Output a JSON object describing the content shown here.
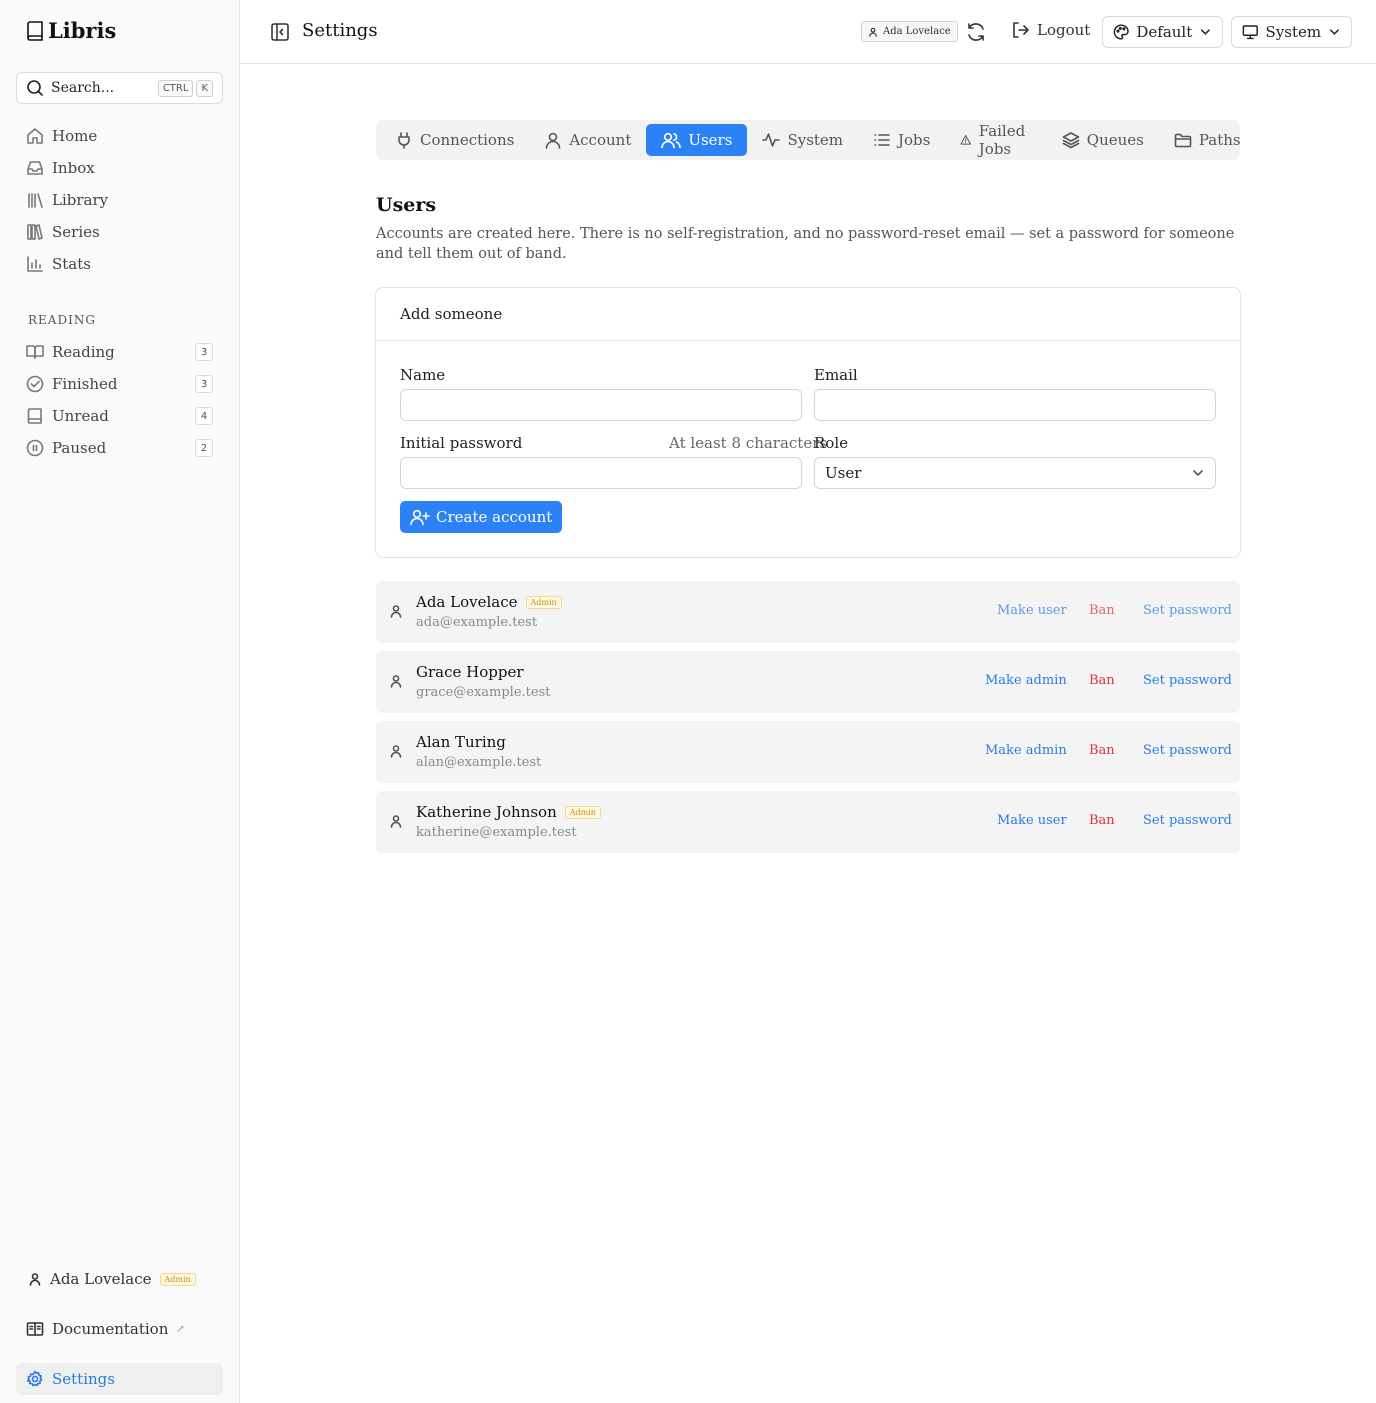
{
  "app": {
    "brand": "Libris"
  },
  "sidebar": {
    "search": {
      "label": "Search...",
      "kbd1": "CTRL",
      "kbd2": "K"
    },
    "nav": [
      {
        "label": "Home",
        "icon": "home-icon"
      },
      {
        "label": "Inbox",
        "icon": "inbox-icon"
      },
      {
        "label": "Library",
        "icon": "library-icon"
      },
      {
        "label": "Series",
        "icon": "series-icon"
      },
      {
        "label": "Stats",
        "icon": "stats-icon"
      }
    ],
    "reading_section": "READING",
    "reading": [
      {
        "label": "Reading",
        "count": "3",
        "icon": "book-open-icon"
      },
      {
        "label": "Finished",
        "count": "3",
        "icon": "check-circle-icon"
      },
      {
        "label": "Unread",
        "count": "4",
        "icon": "book-icon"
      },
      {
        "label": "Paused",
        "count": "2",
        "icon": "pause-circle-icon"
      }
    ],
    "user": {
      "name": "Ada Lovelace",
      "badge": "Admin"
    },
    "documentation": "Documentation",
    "settings": "Settings"
  },
  "header": {
    "title": "Settings",
    "user_chip": "Ada Lovelace",
    "logout": "Logout",
    "theme": "Default",
    "mode": "System"
  },
  "tabs": [
    {
      "label": "Connections",
      "icon": "plug-icon",
      "active": false
    },
    {
      "label": "Account",
      "icon": "user-icon",
      "active": false
    },
    {
      "label": "Users",
      "icon": "users-icon",
      "active": true
    },
    {
      "label": "System",
      "icon": "activity-icon",
      "active": false
    },
    {
      "label": "Jobs",
      "icon": "list-icon",
      "active": false
    },
    {
      "label": "Failed Jobs",
      "icon": "warning-icon",
      "active": false
    },
    {
      "label": "Queues",
      "icon": "layers-icon",
      "active": false
    },
    {
      "label": "Paths",
      "icon": "folder-icon",
      "active": false
    }
  ],
  "page": {
    "heading": "Users",
    "description": "Accounts are created here. There is no self-registration, and no password-reset email — set a password for someone and tell them out of band."
  },
  "form": {
    "title": "Add someone",
    "name_label": "Name",
    "name_value": "",
    "email_label": "Email",
    "email_value": "",
    "password_label": "Initial password",
    "password_hint": "At least 8 characters",
    "password_value": "",
    "role_label": "Role",
    "role_value": "User",
    "submit": "Create account"
  },
  "users": [
    {
      "name": "Ada Lovelace",
      "email": "ada@example.test",
      "badge": "Admin",
      "role_action": "Make user",
      "ban": "Ban",
      "set_password": "Set password",
      "self": true
    },
    {
      "name": "Grace Hopper",
      "email": "grace@example.test",
      "badge": "",
      "role_action": "Make admin",
      "ban": "Ban",
      "set_password": "Set password",
      "self": false
    },
    {
      "name": "Alan Turing",
      "email": "alan@example.test",
      "badge": "",
      "role_action": "Make admin",
      "ban": "Ban",
      "set_password": "Set password",
      "self": false
    },
    {
      "name": "Katherine Johnson",
      "email": "katherine@example.test",
      "badge": "Admin",
      "role_action": "Make user",
      "ban": "Ban",
      "set_password": "Set password",
      "self": false
    }
  ],
  "colors": {
    "accent": "#2b82f6",
    "danger": "#e0303b",
    "admin_badge": "#c7921a"
  }
}
